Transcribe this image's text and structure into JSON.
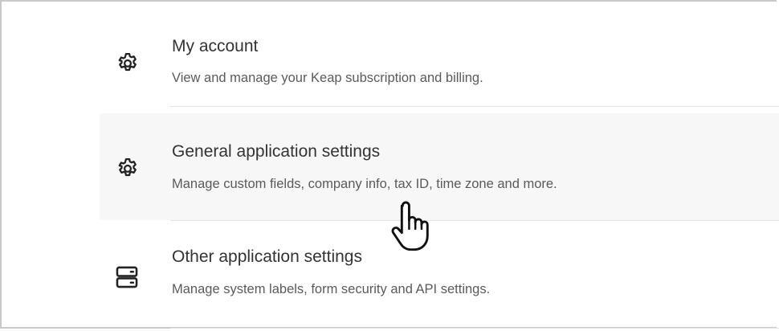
{
  "settings": {
    "items": [
      {
        "title": "My account",
        "description": "View and manage your Keap subscription and billing.",
        "icon": "gear-icon"
      },
      {
        "title": "General application settings",
        "description": "Manage custom fields, company info, tax ID, time zone and more.",
        "icon": "gear-icon"
      },
      {
        "title": "Other application settings",
        "description": "Manage system labels, form security and API settings.",
        "icon": "server-icon"
      }
    ]
  },
  "cursor": {
    "type": "hand-pointer-icon"
  },
  "colors": {
    "hover_row": "#f7f7f7",
    "title": "#333333",
    "description": "#5a5a5a",
    "divider": "#e4e4e4"
  }
}
